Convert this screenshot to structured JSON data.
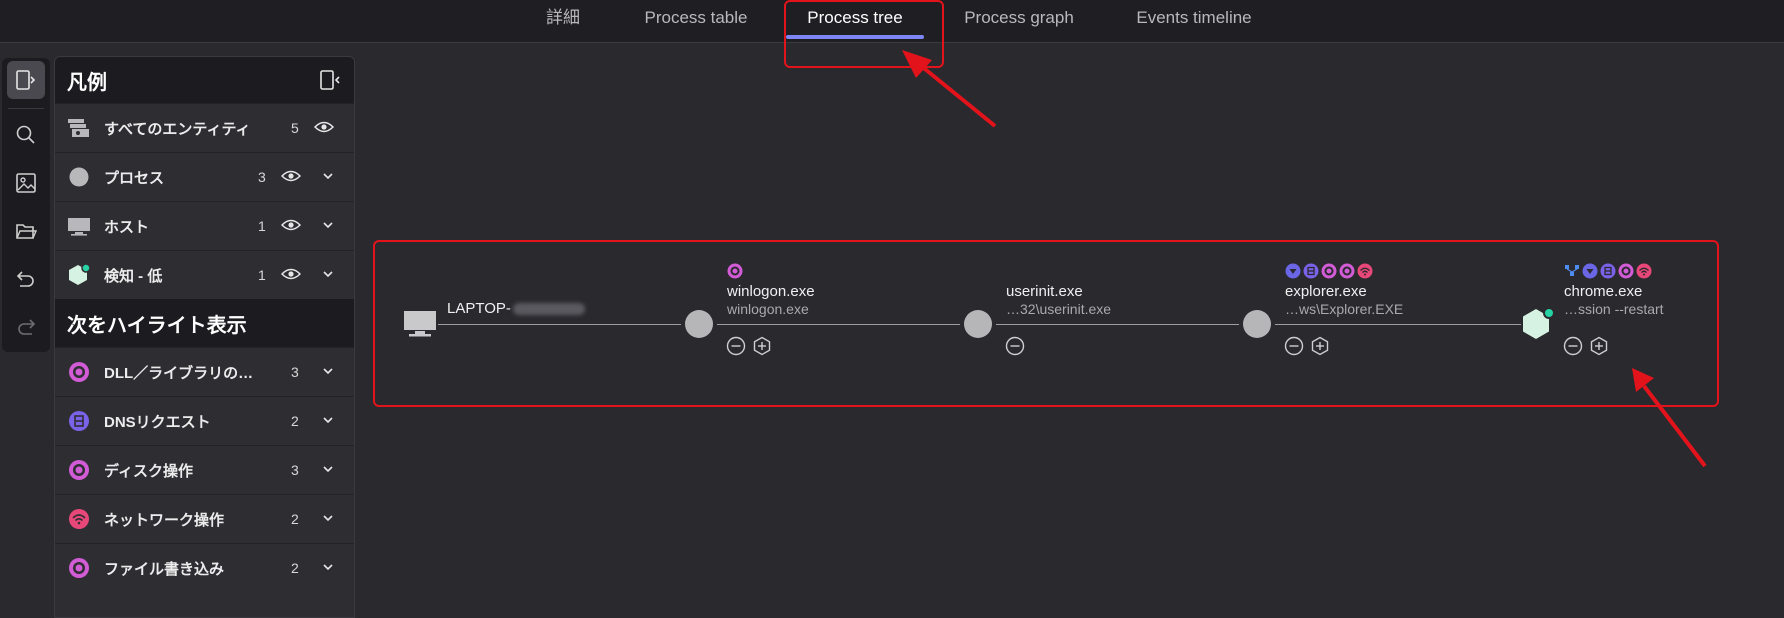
{
  "tabs": [
    {
      "label": "詳細",
      "active": false
    },
    {
      "label": "Process table",
      "active": false
    },
    {
      "label": "Process tree",
      "active": true
    },
    {
      "label": "Process graph",
      "active": false
    },
    {
      "label": "Events timeline",
      "active": false
    }
  ],
  "rail": {
    "icons": [
      "collapse-panel-icon",
      "search-icon",
      "image-icon",
      "folder-icon",
      "undo-icon",
      "redo-icon"
    ]
  },
  "legend": {
    "title": "凡例",
    "entities": [
      {
        "label": "すべてのエンティティ",
        "count": "5",
        "icon": "entities-icon"
      },
      {
        "label": "プロセス",
        "count": "3",
        "icon": "process-icon"
      },
      {
        "label": "ホスト",
        "count": "1",
        "icon": "host-icon"
      },
      {
        "label": "検知 - 低",
        "count": "1",
        "icon": "detection-low-icon"
      }
    ],
    "highlight_title": "次をハイライト表示",
    "highlights": [
      {
        "label": "DLL／ライブラリの…",
        "count": "3",
        "icon": "dll-icon",
        "color": "#d25bd6"
      },
      {
        "label": "DNSリクエスト",
        "count": "2",
        "icon": "dns-icon",
        "color": "#7a63e8"
      },
      {
        "label": "ディスク操作",
        "count": "3",
        "icon": "disk-icon",
        "color": "#d25bd6"
      },
      {
        "label": "ネットワーク操作",
        "count": "2",
        "icon": "network-icon",
        "color": "#e8477a"
      },
      {
        "label": "ファイル書き込み",
        "count": "2",
        "icon": "file-write-icon",
        "color": "#d25bd6"
      }
    ]
  },
  "tree": {
    "host": {
      "name": "LAPTOP-"
    },
    "nodes": [
      {
        "name": "winlogon.exe",
        "path": "winlogon.exe"
      },
      {
        "name": "userinit.exe",
        "path": "…32\\userinit.exe"
      },
      {
        "name": "explorer.exe",
        "path": "…ws\\Explorer.EXE"
      },
      {
        "name": "chrome.exe",
        "path": "…ssion --restart"
      }
    ]
  },
  "colors": {
    "accent": "#7d86f2",
    "annotation_red": "#e3131b",
    "detection_green": "#27d3a4"
  }
}
